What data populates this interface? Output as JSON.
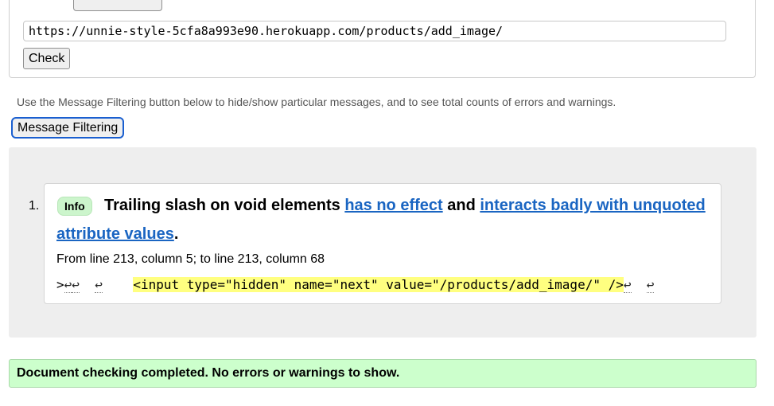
{
  "form": {
    "partial_label": "",
    "url_value": "https://unnie-style-5cfa8a993e90.herokuapp.com/products/add_image/",
    "check_label": "Check"
  },
  "filtering": {
    "hint": "Use the Message Filtering button below to hide/show particular messages, and to see total counts of errors and warnings.",
    "button_label": "Message Filtering"
  },
  "messages": [
    {
      "number": "1.",
      "type_label": "Info",
      "text_before": "Trailing slash on void elements ",
      "link1": "has no effect",
      "text_middle": " and ",
      "link2_part1": "interacts badly with unquoted",
      "link2_part2": "attribute values",
      "text_after": ".",
      "location": "From line 213, column 5; to line 213, column 68",
      "extract_prefix": ">",
      "extract_lf": "↩",
      "extract_spacing": "    ",
      "extract_code": "<input type=\"hidden\" name=\"next\" value=\"/products/add_image/\" />"
    }
  ],
  "result": {
    "summary": "Document checking completed. No errors or warnings to show."
  },
  "colors": {
    "link": "#1a65c2",
    "info_badge": "#ccf5cc",
    "success_bg": "#ccffcc",
    "highlight": "#ffff80",
    "results_bg": "#eeeeee"
  }
}
